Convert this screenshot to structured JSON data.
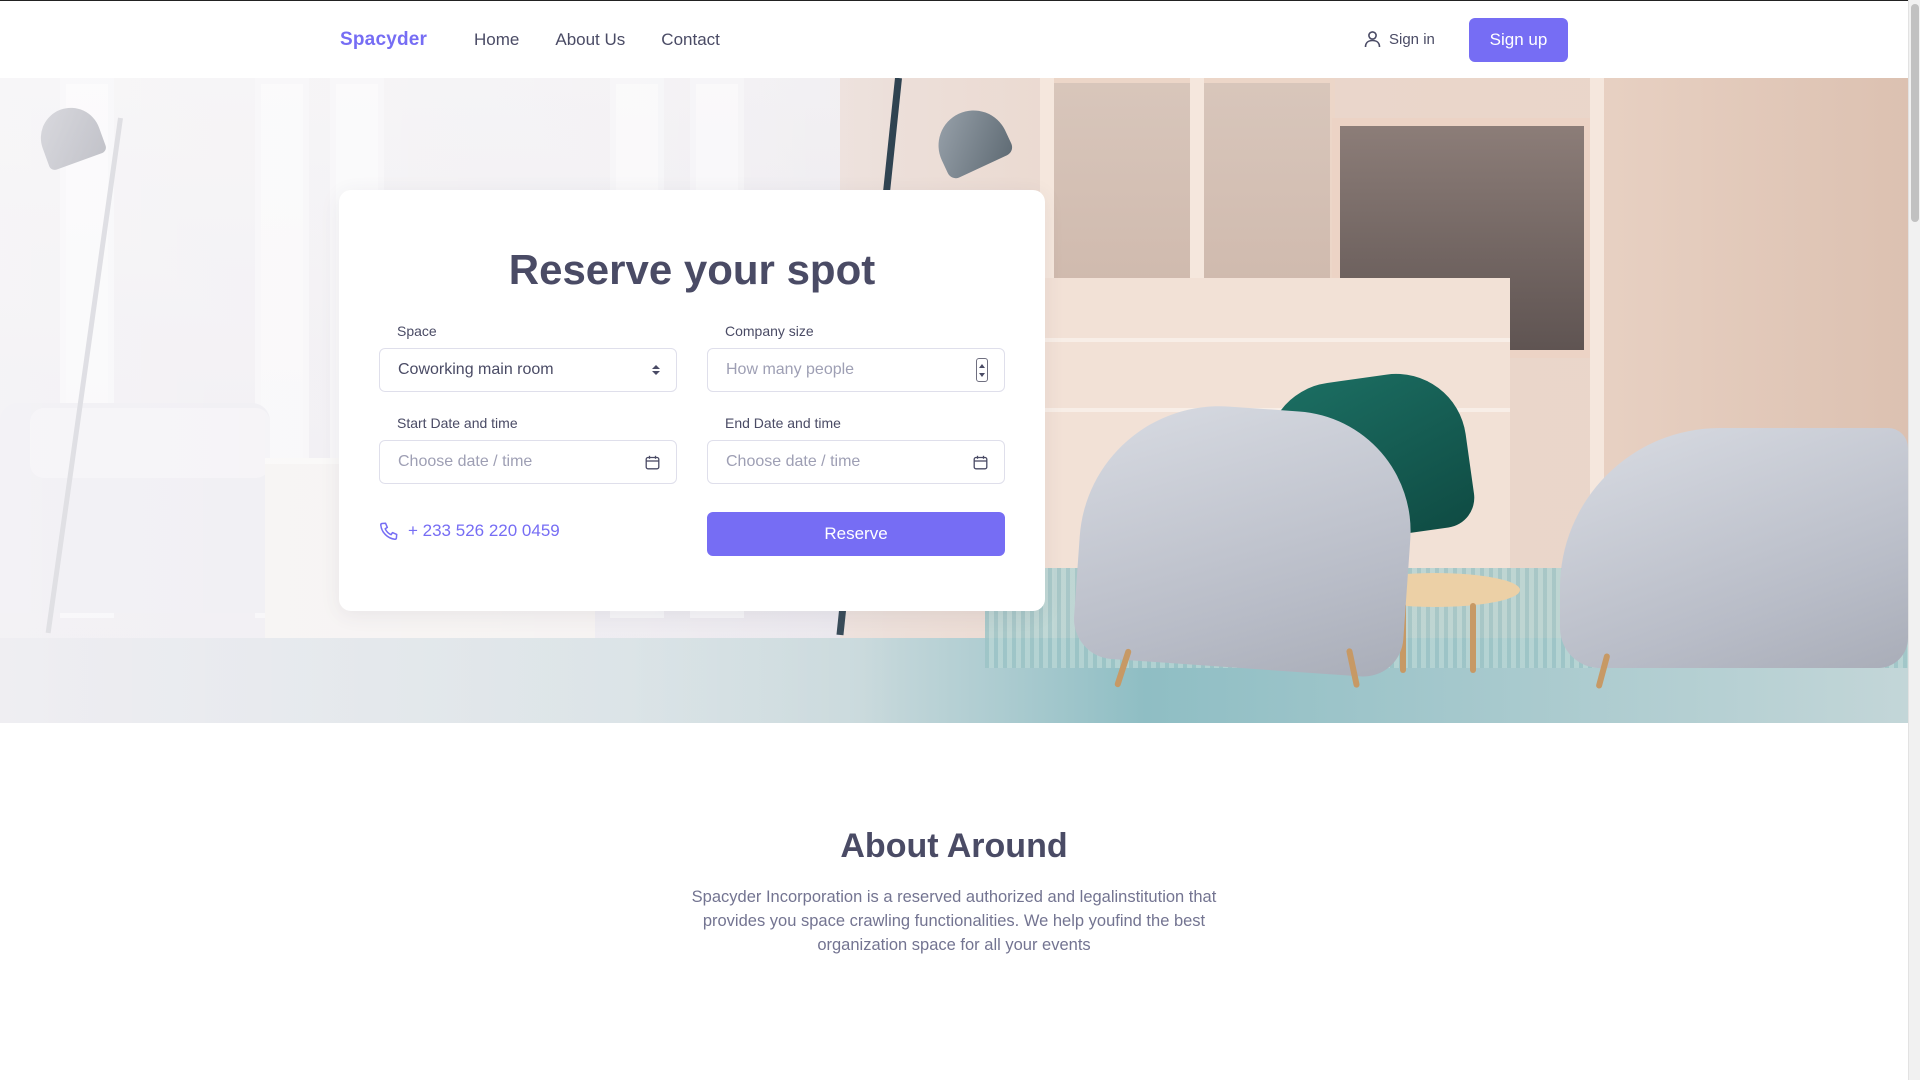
{
  "header": {
    "brand": "Spacyder",
    "nav": [
      "Home",
      "About Us",
      "Contact"
    ],
    "signin_label": "Sign in",
    "signup_label": "Sign up"
  },
  "reservation": {
    "title": "Reserve your spot",
    "space": {
      "label": "Space",
      "value": "Coworking main room"
    },
    "company_size": {
      "label": "Company size",
      "placeholder": "How many people"
    },
    "start": {
      "label": "Start Date and time",
      "placeholder": "Choose date / time"
    },
    "end": {
      "label": "End Date and time",
      "placeholder": "Choose date / time"
    },
    "phone": "+ 233 526 220 0459",
    "reserve_label": "Reserve"
  },
  "about": {
    "title": "About Around",
    "text": "Spacyder Incorporation is a reserved authorized and legalinstitution that provides you space crawling functionalities. We help youfind the best organization space for all your events"
  },
  "colors": {
    "accent": "#766df4",
    "heading": "#4a4b65",
    "muted": "#737491"
  },
  "icons": {
    "signin": "user-icon",
    "phone": "phone-icon",
    "calendar": "calendar-icon"
  }
}
